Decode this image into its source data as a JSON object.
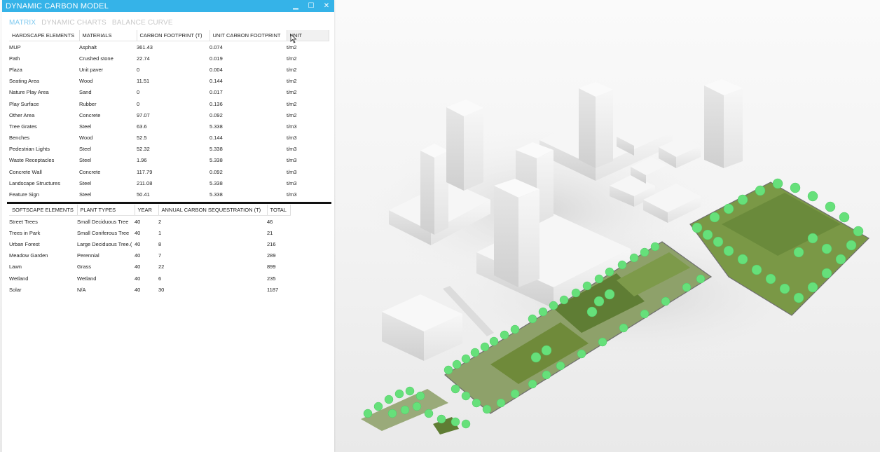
{
  "window": {
    "title": "DYNAMIC CARBON MODEL",
    "minimize_glyph": "▁",
    "maximize_glyph": "☐",
    "close_glyph": "✕"
  },
  "tabs": [
    {
      "label": "MATRIX",
      "active": true
    },
    {
      "label": "DYNAMIC CHARTS",
      "active": false
    },
    {
      "label": "BALANCE CURVE",
      "active": false
    }
  ],
  "hardscape": {
    "columns": [
      "HARDSCAPE ELEMENTS",
      "MATERIALS",
      "CARBON FOOTPRINT (T)",
      "UNIT CARBON FOOTPRINT",
      "UNIT"
    ],
    "rows": [
      [
        "MUP",
        "Asphalt",
        "361.43",
        "0.074",
        "t/m2"
      ],
      [
        "Path",
        "Crushed stone",
        "22.74",
        "0.019",
        "t/m2"
      ],
      [
        "Plaza",
        "Unit paver",
        "0",
        "0.004",
        "t/m2"
      ],
      [
        "Seating Area",
        "Wood",
        "11.51",
        "0.144",
        "t/m2"
      ],
      [
        "Nature Play Area",
        "Sand",
        "0",
        "0.017",
        "t/m2"
      ],
      [
        "Play Surface",
        "Rubber",
        "0",
        "0.136",
        "t/m2"
      ],
      [
        "Other Area",
        "Concrete",
        "97.07",
        "0.092",
        "t/m2"
      ],
      [
        "Tree Grates",
        "Steel",
        "63.6",
        "5.338",
        "t/m3"
      ],
      [
        "Benches",
        "Wood",
        "52.5",
        "0.144",
        "t/m3"
      ],
      [
        "Pedestrian Lights",
        "Steel",
        "52.32",
        "5.338",
        "t/m3"
      ],
      [
        "Waste Receptacles",
        "Steel",
        "1.96",
        "5.338",
        "t/m3"
      ],
      [
        "Concrete Wall",
        "Concrete",
        "117.79",
        "0.092",
        "t/m3"
      ],
      [
        "Landscape Structures",
        "Steel",
        "211.08",
        "5.338",
        "t/m3"
      ],
      [
        "Feature Sign",
        "Steel",
        "50.41",
        "5.338",
        "t/m3"
      ]
    ]
  },
  "softscape": {
    "columns": [
      "SOFTSCAPE ELEMENTS",
      "PLANT TYPES",
      "YEAR",
      "ANNUAL CARBON SEQUESTRATION (T)",
      "TOTAL"
    ],
    "rows": [
      [
        "Street Trees",
        "Small Deciduous Tree",
        "40",
        "2",
        "46"
      ],
      [
        "Trees in Park",
        "Small Coniferous Tree",
        "40",
        "1",
        "21"
      ],
      [
        "Urban Forest",
        "Large Deciduous Tree.(",
        "40",
        "8",
        "216"
      ],
      [
        "Meadow Garden",
        "Perennial",
        "40",
        "7",
        "289"
      ],
      [
        "Lawn",
        "Grass",
        "40",
        "22",
        "899"
      ],
      [
        "Wetland",
        "Wetland",
        "40",
        "6",
        "235"
      ],
      [
        "Solar",
        "N/A",
        "40",
        "30",
        "1187"
      ]
    ]
  },
  "colors": {
    "accent": "#35b3e8",
    "active_tab": "#7fcaf0",
    "inactive_tab": "#c8c8c8",
    "vegetation": "#66e07a",
    "lawn": "#6f8a3a",
    "building": "#ececec"
  },
  "icons": {
    "minimize": "minimize-icon",
    "maximize": "maximize-icon",
    "close": "close-icon",
    "cursor": "mouse-cursor-icon"
  }
}
